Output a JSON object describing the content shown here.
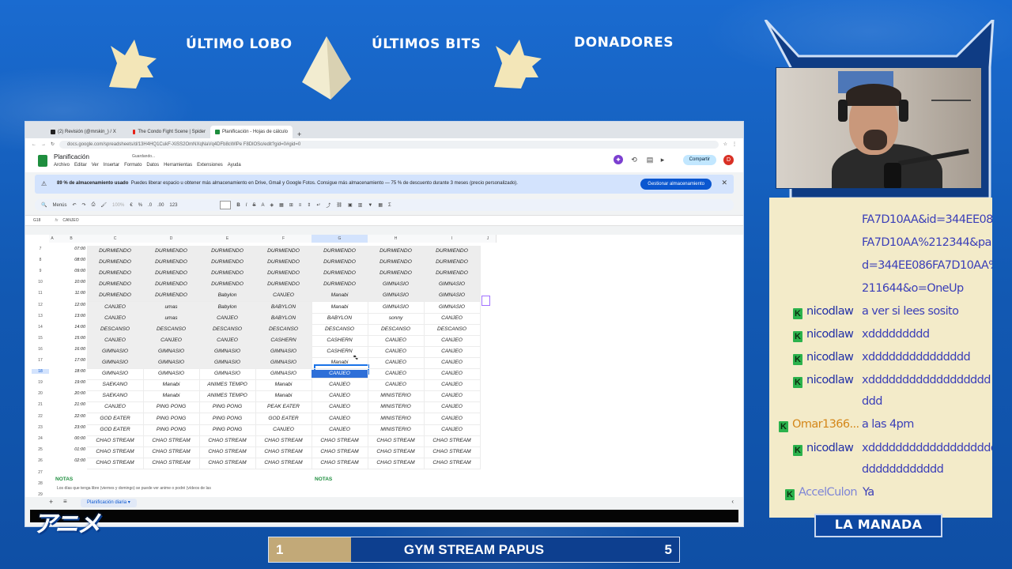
{
  "overlay": {
    "banner": {
      "left_label": "ÚLTIMO LOBO",
      "mid_label": "ÚLTIMOS BITS",
      "right_label": "DONADORES"
    },
    "manada_label": "LA MANADA",
    "anime_logo": "アニメ",
    "goal": {
      "current": "1",
      "label": "GYM STREAM PAPUS",
      "target": "5",
      "progress": 0.2
    }
  },
  "browser": {
    "tabs": [
      {
        "label": "(2) Revisión (@mrskin_) / X",
        "color": "#222222"
      },
      {
        "label": "The Condo Fight Scene | Spider",
        "color": "#e62117"
      },
      {
        "label": "Planificación - Hojas de cálculo",
        "color": "#1e8e3e"
      }
    ],
    "url": "docs.google.com/spreadsheets/d/13H4HQ1CukF-XiSS2OmNXqNaVq4DFb8cWlPe F8DlOSo/edit?gid=0#gid=0"
  },
  "sheet": {
    "title": "Planificación",
    "status": "Guardando...",
    "menu": [
      "Archivo",
      "Editar",
      "Ver",
      "Insertar",
      "Formato",
      "Datos",
      "Herramientas",
      "Extensiones",
      "Ayuda"
    ],
    "share_label": "Compartir",
    "avatar": "D",
    "storage": {
      "text_bold": "89 % de almacenamiento usado",
      "text": "Puedes liberar espacio u obtener más almacenamiento en Drive, Gmail y Google Fotos. Consigue más almacenamiento — 75 % de descuento durante 3 meses (precio personalizado).",
      "button": "Gestionar almacenamiento"
    },
    "toolbar": {
      "search": "Menús",
      "zoom": "100%",
      "currency": "€",
      "percent": "%",
      "dec1": ".0",
      "dec2": ".00",
      "format123": "123",
      "font_size": ""
    },
    "formula": {
      "cell_ref": "G18",
      "fx": "fx",
      "value": "CANJEO"
    },
    "col_heads": [
      "A",
      "B",
      "C",
      "D",
      "E",
      "F",
      "G",
      "H",
      "I",
      "J"
    ],
    "rows": [
      {
        "n": "7",
        "time": "07:00",
        "cells": [
          "DURMIENDO",
          "DURMIENDO",
          "DURMIENDO",
          "DURMIENDO",
          "DURMIENDO",
          "DURMIENDO",
          "DURMIENDO"
        ]
      },
      {
        "n": "8",
        "time": "08:00",
        "cells": [
          "DURMIENDO",
          "DURMIENDO",
          "DURMIENDO",
          "DURMIENDO",
          "DURMIENDO",
          "DURMIENDO",
          "DURMIENDO"
        ]
      },
      {
        "n": "9",
        "time": "09:00",
        "cells": [
          "DURMIENDO",
          "DURMIENDO",
          "DURMIENDO",
          "DURMIENDO",
          "DURMIENDO",
          "DURMIENDO",
          "DURMIENDO"
        ]
      },
      {
        "n": "10",
        "time": "10:00",
        "cells": [
          "DURMIENDO",
          "DURMIENDO",
          "DURMIENDO",
          "DURMIENDO",
          "DURMIENDO",
          "GIMNASIO",
          "GIMNASIO"
        ]
      },
      {
        "n": "11",
        "time": "11:00",
        "cells": [
          "DURMIENDO",
          "DURMIENDO",
          "Babylon",
          "CANJEO",
          "Manabi",
          "GIMNASIO",
          "GIMNASIO"
        ]
      },
      {
        "n": "12",
        "time": "12:00",
        "cells": [
          "CANJEO",
          "umas",
          "Babylon",
          "BABYLON",
          "Manabi",
          "GIMNASIO",
          "GIMNASIO"
        ]
      },
      {
        "n": "13",
        "time": "13:00",
        "cells": [
          "CANJEO",
          "umas",
          "CANJEO",
          "BABYLON",
          "BABYLON",
          "sonny",
          "CANJEO"
        ]
      },
      {
        "n": "14",
        "time": "14:00",
        "cells": [
          "DESCANSO",
          "DESCANSO",
          "DESCANSO",
          "DESCANSO",
          "DESCANSO",
          "DESCANSO",
          "DESCANSO"
        ]
      },
      {
        "n": "15",
        "time": "15:00",
        "cells": [
          "CANJEO",
          "CANJEO",
          "CANJEO",
          "CASHERN",
          "CASHERN",
          "CANJEO",
          "CANJEO"
        ]
      },
      {
        "n": "16",
        "time": "16:00",
        "cells": [
          "GIMNASIO",
          "GIMNASIO",
          "GIMNASIO",
          "GIMNASIO",
          "CASHERN",
          "CANJEO",
          "CANJEO"
        ]
      },
      {
        "n": "17",
        "time": "17:00",
        "cells": [
          "GIMNASIO",
          "GIMNASIO",
          "GIMNASIO",
          "GIMNASIO",
          "Manabi",
          "CANJEO",
          "CANJEO"
        ]
      },
      {
        "n": "18",
        "time": "18:00",
        "cells": [
          "GIMNASIO",
          "GIMNASIO",
          "GIMNASIO",
          "GIMNASIO",
          "CANJEO",
          "CANJEO",
          "CANJEO"
        ]
      },
      {
        "n": "19",
        "time": "19:00",
        "cells": [
          "SAEKANO",
          "Manabi",
          "ANIMES TEMPO",
          "Manabi",
          "CANJEO",
          "CANJEO",
          "CANJEO"
        ]
      },
      {
        "n": "20",
        "time": "20:00",
        "cells": [
          "SAEKANO",
          "Manabi",
          "ANIMES TEMPO",
          "Manabi",
          "CANJEO",
          "MINISTERIO",
          "CANJEO"
        ]
      },
      {
        "n": "21",
        "time": "21:00",
        "cells": [
          "CANJEO",
          "PING PONG",
          "PING PONG",
          "PEAK EATER",
          "CANJEO",
          "MINISTERIO",
          "CANJEO"
        ]
      },
      {
        "n": "22",
        "time": "22:00",
        "cells": [
          "GOD EATER",
          "PING PONG",
          "PING PONG",
          "GOD EATER",
          "CANJEO",
          "MINISTERIO",
          "CANJEO"
        ]
      },
      {
        "n": "23",
        "time": "23:00",
        "cells": [
          "GOD EATER",
          "PING PONG",
          "PING PONG",
          "CANJEO",
          "CANJEO",
          "MINISTERIO",
          "CANJEO"
        ]
      },
      {
        "n": "24",
        "time": "00:00",
        "cells": [
          "CHAO STREAM",
          "CHAO STREAM",
          "CHAO STREAM",
          "CHAO STREAM",
          "CHAO STREAM",
          "CHAO STREAM",
          "CHAO STREAM"
        ]
      },
      {
        "n": "25",
        "time": "01:00",
        "cells": [
          "CHAO STREAM",
          "CHAO STREAM",
          "CHAO STREAM",
          "CHAO STREAM",
          "CHAO STREAM",
          "CHAO STREAM",
          "CHAO STREAM"
        ]
      },
      {
        "n": "26",
        "time": "02:00",
        "cells": [
          "CHAO STREAM",
          "CHAO STREAM",
          "CHAO STREAM",
          "CHAO STREAM",
          "CHAO STREAM",
          "CHAO STREAM",
          "CHAO STREAM"
        ]
      }
    ],
    "extra_rows": [
      "27",
      "28",
      "29"
    ],
    "notes_left": "NOTAS",
    "notes_right": "NOTAS",
    "notes_text": "Los días que tenga libre (viernes y domingo) se puede ver anime o podré (vídeos de las",
    "sheet_tab": "Planificación diaria"
  },
  "chat": {
    "lines": [
      {
        "user": "",
        "text": "FA7D10AA&id=344EE086"
      },
      {
        "user": "",
        "text": "FA7D10AA%212344&parl"
      },
      {
        "user": "",
        "text": "d=344EE086FA7D10AA%"
      },
      {
        "user": "",
        "text": "211644&o=OneUp"
      },
      {
        "user": "nicodlaw",
        "text": "a ver si lees sosito"
      },
      {
        "user": "nicodlaw",
        "text": "xddddddddd"
      },
      {
        "user": "nicodlaw",
        "text": "xddddddddddddddd"
      },
      {
        "user": "nicodlaw",
        "text": "xdddddddddddddddddd"
      },
      {
        "user": "",
        "text": "ddd"
      },
      {
        "user": "Omar1366...",
        "text": "a las 4pm"
      },
      {
        "user": "nicodlaw",
        "text": "xddddddddddddddddddd"
      },
      {
        "user": "",
        "text": "dddddddddddd"
      },
      {
        "user": "AccelCulon",
        "text": "Ya"
      }
    ],
    "user_colors": {
      "nicodlaw": "#2230a6",
      "Omar1366...": "#d4871a",
      "AccelCulon": "#7f86d6"
    }
  }
}
